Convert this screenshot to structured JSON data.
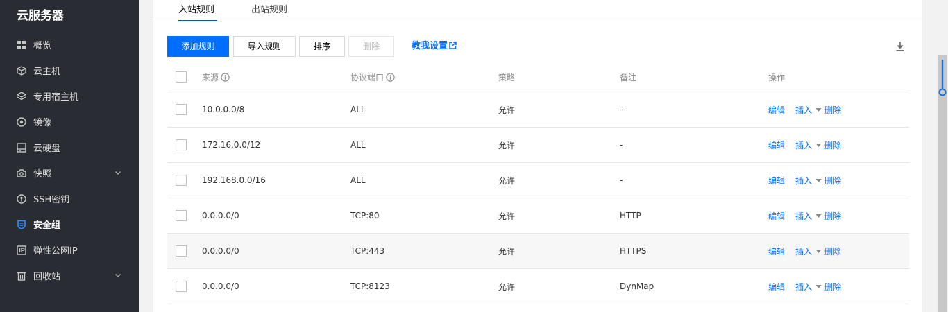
{
  "sidebar": {
    "brand": "云服务器",
    "items": [
      {
        "label": "概览",
        "icon": "grid-icon"
      },
      {
        "label": "云主机",
        "icon": "cube-icon"
      },
      {
        "label": "专用宿主机",
        "icon": "layers-icon"
      },
      {
        "label": "镜像",
        "icon": "disc-icon"
      },
      {
        "label": "云硬盘",
        "icon": "disk-icon"
      },
      {
        "label": "快照",
        "icon": "camera-icon",
        "expandable": true
      },
      {
        "label": "SSH密钥",
        "icon": "key-icon"
      },
      {
        "label": "安全组",
        "icon": "shield-icon",
        "active": true
      },
      {
        "label": "弹性公网IP",
        "icon": "ip-icon"
      },
      {
        "label": "回收站",
        "icon": "trash-icon",
        "expandable": true
      }
    ]
  },
  "tabs": [
    {
      "label": "入站规则",
      "active": true
    },
    {
      "label": "出站规则",
      "active": false
    }
  ],
  "toolbar": {
    "add_label": "添加规则",
    "import_label": "导入规则",
    "sort_label": "排序",
    "delete_label": "删除",
    "guide_label": "教我设置"
  },
  "table": {
    "headers": {
      "source": "来源",
      "protocol": "协议端口",
      "policy": "策略",
      "remark": "备注",
      "action": "操作"
    },
    "actions": {
      "edit": "编辑",
      "insert": "插入",
      "delete": "删除"
    },
    "rows": [
      {
        "source": "10.0.0.0/8",
        "protocol": "ALL",
        "policy": "允许",
        "remark": "-"
      },
      {
        "source": "172.16.0.0/12",
        "protocol": "ALL",
        "policy": "允许",
        "remark": "-"
      },
      {
        "source": "192.168.0.0/16",
        "protocol": "ALL",
        "policy": "允许",
        "remark": "-"
      },
      {
        "source": "0.0.0.0/0",
        "protocol": "TCP:80",
        "policy": "允许",
        "remark": "HTTP"
      },
      {
        "source": "0.0.0.0/0",
        "protocol": "TCP:443",
        "policy": "允许",
        "remark": "HTTPS"
      },
      {
        "source": "0.0.0.0/0",
        "protocol": "TCP:8123",
        "policy": "允许",
        "remark": "DynMap"
      }
    ]
  },
  "colors": {
    "sidebar_bg": "#292d33",
    "primary": "#006eff",
    "active_icon": "#2e8fff"
  }
}
